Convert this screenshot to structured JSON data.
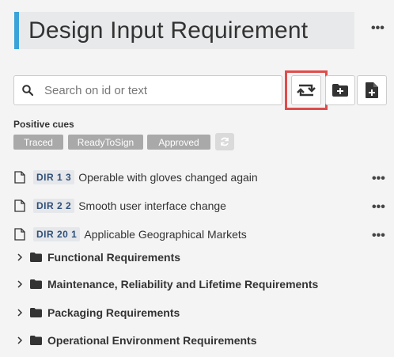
{
  "header": {
    "title": "Design Input Requirement",
    "menu_glyph": "•••"
  },
  "search": {
    "placeholder": "Search on id or text",
    "value": ""
  },
  "toolbar": {
    "buttons": [
      {
        "icon": "swap-arrows-icon",
        "highlighted": true
      },
      {
        "icon": "folder-plus-icon"
      },
      {
        "icon": "file-plus-icon"
      }
    ],
    "highlight_color": "#e04b4b"
  },
  "cues": {
    "label": "Positive cues",
    "chips": [
      "Traced",
      "ReadyToSign",
      "Approved"
    ]
  },
  "documents": [
    {
      "id": "DIR 1 3",
      "title": "Operable with gloves changed again",
      "menu": "•••"
    },
    {
      "id": "DIR 2 2",
      "title": "Smooth user interface change",
      "menu": "•••"
    },
    {
      "id": "DIR 20 1",
      "title": "Applicable Geographical Markets",
      "menu": "•••"
    }
  ],
  "folders": [
    {
      "label": "Functional Requirements"
    },
    {
      "label": "Maintenance, Reliability and Lifetime Requirements"
    },
    {
      "label": "Packaging Requirements"
    },
    {
      "label": "Operational Environment Requirements"
    }
  ],
  "colors": {
    "accent": "#3aa3d8",
    "chip_bg": "#a9a9a9",
    "id_text": "#2f4f7a"
  }
}
